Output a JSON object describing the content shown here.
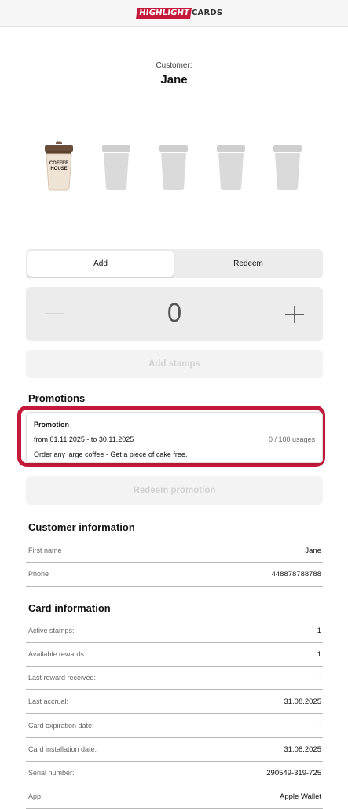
{
  "header": {
    "logo_part1": "HIGHLIGHT",
    "logo_part2": "CARDS",
    "accent_color": "#c4193a"
  },
  "customer": {
    "label": "Customer:",
    "name": "Jane"
  },
  "stamp_card": {
    "total_slots": 5,
    "filled_slots": 1,
    "filled_cup_text_line1": "COFFEE",
    "filled_cup_text_line2": "HOUSE"
  },
  "mode_toggle": {
    "options": [
      "Add",
      "Redeem"
    ],
    "selected": "Add"
  },
  "stepper": {
    "value": "0",
    "minus_icon": "minus-icon",
    "plus_icon": "plus-icon"
  },
  "add_stamps_button": "Add stamps",
  "promotions": {
    "title": "Promotions",
    "items": [
      {
        "title": "Promotion",
        "dates": "from 01.11.2025 - to 30.11.2025",
        "usage": "0 / 100 usages",
        "description": "Order any large coffee - Get a piece of cake free."
      }
    ],
    "redeem_button": "Redeem promotion"
  },
  "customer_info": {
    "title": "Customer information",
    "rows": [
      {
        "key": "First name",
        "value": "Jane"
      },
      {
        "key": "Phone",
        "value": "448878788788"
      }
    ]
  },
  "card_info": {
    "title": "Card information",
    "rows": [
      {
        "key": "Active stamps:",
        "value": "1"
      },
      {
        "key": "Available rewards:",
        "value": "1"
      },
      {
        "key": "Last reward received:",
        "value": "-"
      },
      {
        "key": "Last accrual:",
        "value": "31.08.2025"
      },
      {
        "key": "Card expiration date:",
        "value": "-"
      },
      {
        "key": "Card installation date:",
        "value": "31.08.2025"
      },
      {
        "key": "Serial number:",
        "value": "290549-319-725"
      },
      {
        "key": "App:",
        "value": "Apple Wallet"
      }
    ]
  }
}
